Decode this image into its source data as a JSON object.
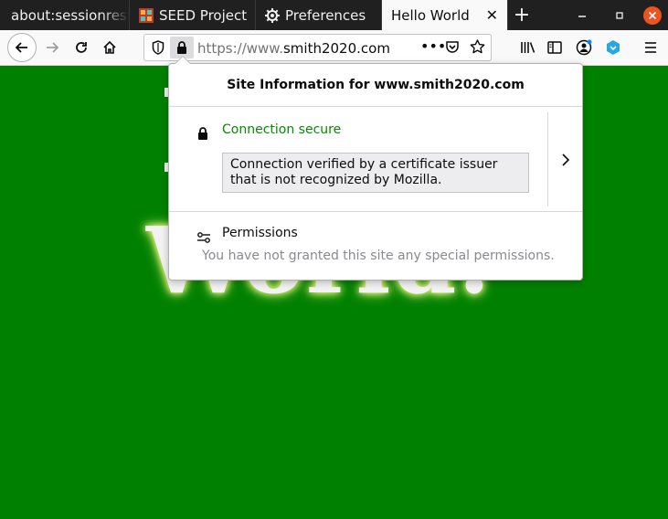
{
  "tabs": [
    {
      "label": "about:sessionrestore"
    },
    {
      "label": "SEED Project"
    },
    {
      "label": "Preferences"
    },
    {
      "label": "Hello World"
    }
  ],
  "urlbar": {
    "scheme": "https://www.",
    "host": "smith2020.com"
  },
  "page": {
    "visible_text": "World."
  },
  "popup": {
    "title": "Site Information for www.smith2020.com",
    "connection_label": "Connection secure",
    "connection_detail": "Connection verified by a certificate issuer that is not recognized by Mozilla.",
    "permissions_title": "Permissions",
    "permissions_desc": "You have not granted this site any special permissions."
  },
  "colors": {
    "page_background": "#008000",
    "secure_green": "#058b00",
    "close_button": "#e95420"
  }
}
